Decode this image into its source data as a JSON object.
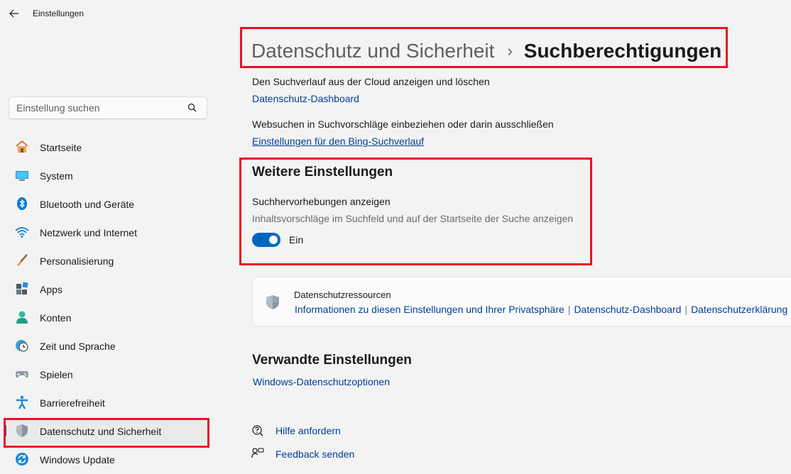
{
  "app": {
    "title": "Einstellungen"
  },
  "search": {
    "placeholder": "Einstellung suchen"
  },
  "sidebar": {
    "items": [
      {
        "label": "Startseite",
        "icon": "home-icon"
      },
      {
        "label": "System",
        "icon": "monitor-icon"
      },
      {
        "label": "Bluetooth und Geräte",
        "icon": "bluetooth-icon"
      },
      {
        "label": "Netzwerk und Internet",
        "icon": "wifi-icon"
      },
      {
        "label": "Personalisierung",
        "icon": "brush-icon"
      },
      {
        "label": "Apps",
        "icon": "apps-icon"
      },
      {
        "label": "Konten",
        "icon": "person-icon"
      },
      {
        "label": "Zeit und Sprache",
        "icon": "clock-globe-icon"
      },
      {
        "label": "Spielen",
        "icon": "gamepad-icon"
      },
      {
        "label": "Barrierefreiheit",
        "icon": "accessibility-icon"
      },
      {
        "label": "Datenschutz und Sicherheit",
        "icon": "shield-icon",
        "active": true
      },
      {
        "label": "Windows Update",
        "icon": "update-icon"
      }
    ]
  },
  "header": {
    "parent": "Datenschutz und Sicherheit",
    "separator": "›",
    "current": "Suchberechtigungen"
  },
  "content": {
    "cloud_history_text": "Den Suchverlauf aus der Cloud anzeigen und löschen",
    "dashboard_link": "Datenschutz-Dashboard",
    "websearch_text": "Websuchen in Suchvorschläge einbeziehen oder darin ausschließen",
    "bing_link": "Einstellungen für den Bing-Suchverlauf",
    "more_settings": {
      "heading": "Weitere Einstellungen",
      "title": "Suchhervorhebungen anzeigen",
      "description": "Inhaltsvorschläge im Suchfeld und auf der Startseite der Suche anzeigen",
      "toggle_state": "Ein",
      "toggle_on": true
    },
    "resources": {
      "title": "Datenschutzressourcen",
      "links": [
        "Informationen zu diesen Einstellungen und Ihrer Privatsphäre",
        "Datenschutz-Dashboard",
        "Datenschutzerklärung"
      ],
      "separator": "|"
    },
    "related": {
      "heading": "Verwandte Einstellungen",
      "link": "Windows-Datenschutzoptionen"
    },
    "footer": {
      "help": "Hilfe anfordern",
      "feedback": "Feedback senden"
    }
  },
  "colors": {
    "accent": "#0067c0",
    "link": "#003e92",
    "highlight": "#e81123",
    "background": "#f3f3f3"
  }
}
